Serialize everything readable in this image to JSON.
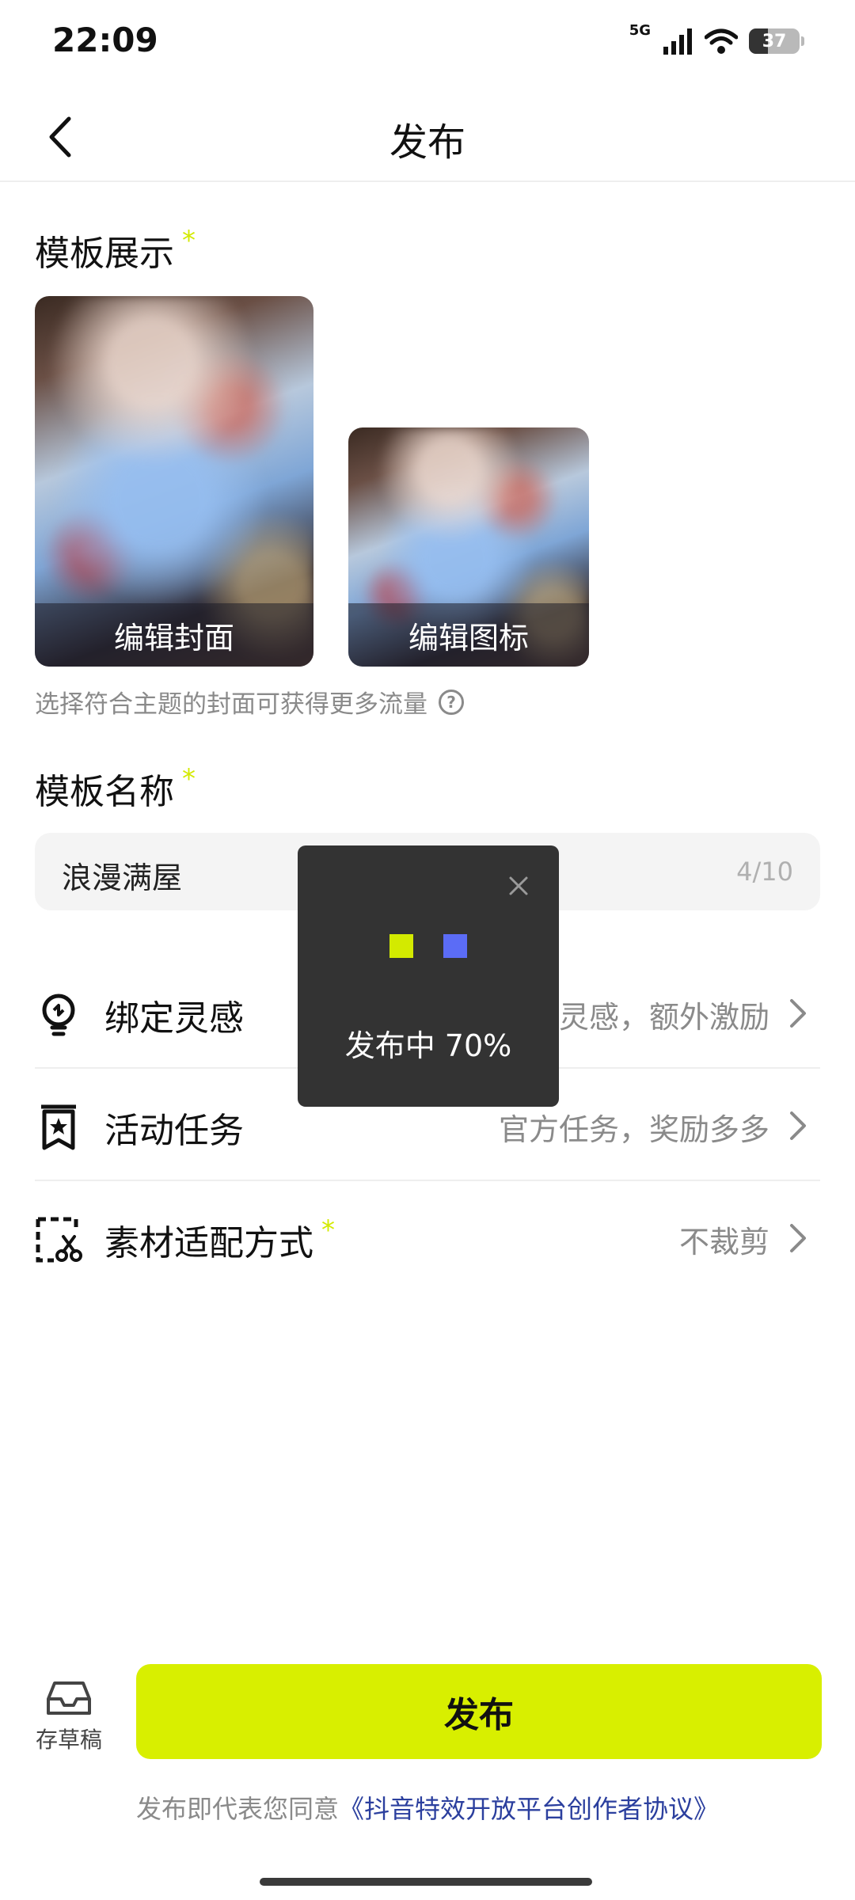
{
  "status_bar": {
    "time": "22:09",
    "network_label": "5G",
    "battery_level": "37"
  },
  "nav": {
    "title": "发布"
  },
  "template_display": {
    "title": "模板展示",
    "required_mark": "*",
    "cover_label": "编辑封面",
    "icon_label": "编辑图标",
    "hint": "选择符合主题的封面可获得更多流量"
  },
  "template_name": {
    "title": "模板名称",
    "required_mark": "*",
    "value": "浪漫满屋",
    "counter": "4/10"
  },
  "settings_rows": [
    {
      "label": "绑定灵感",
      "value": "灵感，额外激励",
      "icon": "lightbulb-icon"
    },
    {
      "label": "活动任务",
      "value": "官方任务，奖励多多",
      "icon": "bookmark-star-icon"
    },
    {
      "label": "素材适配方式",
      "required_mark": "*",
      "value": "不裁剪",
      "icon": "crop-scissors-icon"
    }
  ],
  "bottom": {
    "draft_label": "存草稿",
    "publish_label": "发布",
    "agreement_prefix": "发布即代表您同意",
    "agreement_link": "《抖音特效开放平台创作者协议》"
  },
  "toast": {
    "text": "发布中 70%",
    "progress": 0.7
  },
  "colors": {
    "accent": "#d8ef00",
    "link": "#2b3f9e",
    "toast_bg": "#333333",
    "dot_yellow": "#d3ea00",
    "dot_blue": "#5b6cf6"
  }
}
